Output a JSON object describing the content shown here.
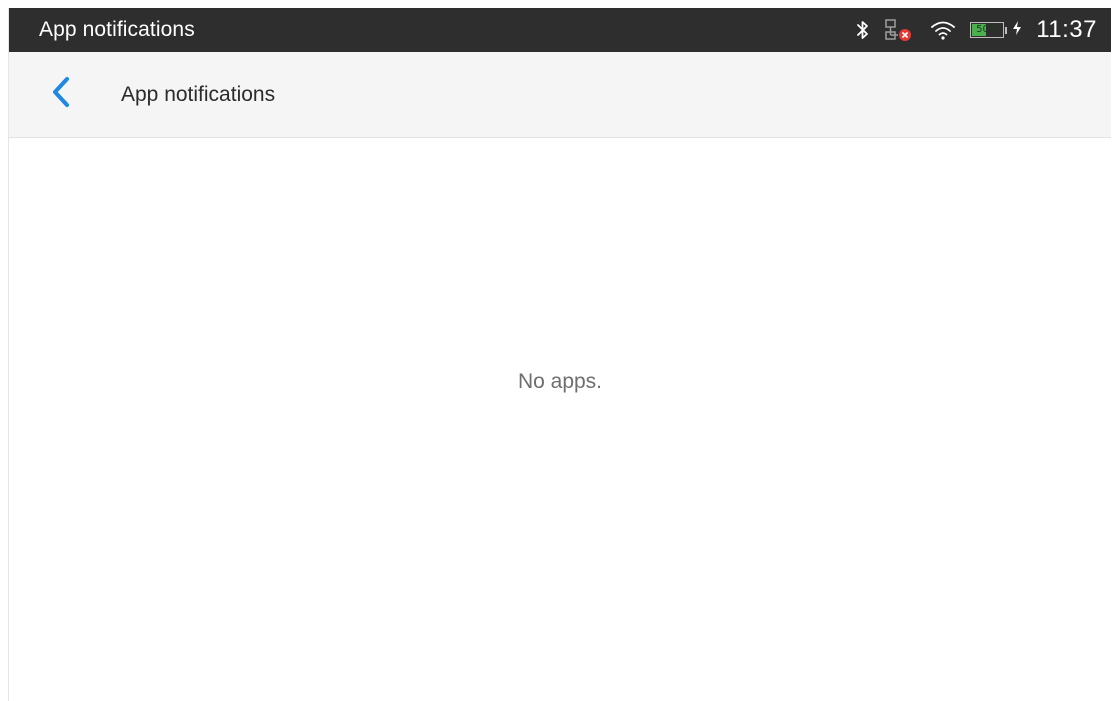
{
  "status_bar": {
    "title": "App notifications",
    "time": "11:37",
    "battery": {
      "label": "50%",
      "level": 0.5,
      "color": "#4caf50",
      "charging": true
    },
    "icons": [
      "bluetooth-icon",
      "network-disconnected-icon",
      "wifi-icon",
      "battery-icon",
      "charging-bolt-icon"
    ]
  },
  "toolbar": {
    "back_icon": "chevron-left-icon",
    "title": "App notifications",
    "accent_color": "#1e88e5"
  },
  "content": {
    "empty_message": "No apps."
  }
}
